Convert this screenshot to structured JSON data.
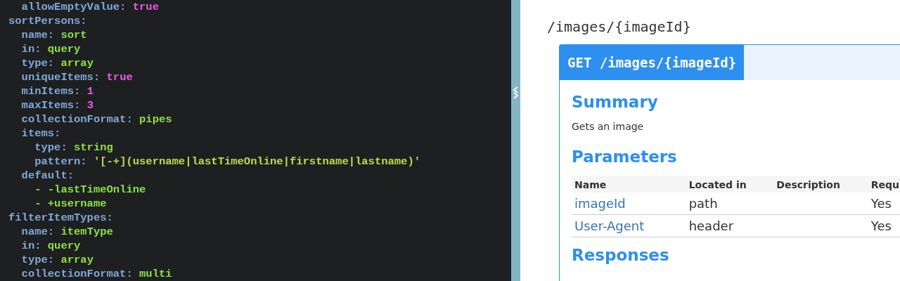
{
  "editor": {
    "lines": [
      {
        "children": [
          {
            "key": "allowEmptyValue:",
            "value": "true",
            "kind": "literal"
          }
        ]
      },
      {
        "key": "sortPersons:",
        "children": [
          {
            "key": "name:",
            "value": "sort",
            "kind": "string"
          },
          {
            "key": "in:",
            "value": "query",
            "kind": "string"
          },
          {
            "key": "type:",
            "value": "array",
            "kind": "string"
          },
          {
            "key": "uniqueItems:",
            "value": "true",
            "kind": "literal"
          },
          {
            "key": "minItems:",
            "value": "1",
            "kind": "literal"
          },
          {
            "key": "maxItems:",
            "value": "3",
            "kind": "literal"
          },
          {
            "key": "collectionFormat:",
            "value": "pipes",
            "kind": "string"
          },
          {
            "key": "items:",
            "children": [
              {
                "key": "type:",
                "value": "string",
                "kind": "string"
              },
              {
                "key": "pattern:",
                "value": "'[-+](username|lastTimeOnline|firstname|lastname)'",
                "kind": "quoted"
              }
            ]
          },
          {
            "key": "default:",
            "children": [
              {
                "item": "- -lastTimeOnline",
                "kind": "list"
              },
              {
                "item": "- +username",
                "kind": "list"
              }
            ]
          }
        ]
      },
      {
        "key": "filterItemTypes:",
        "children": [
          {
            "key": "name:",
            "value": "itemType",
            "kind": "string"
          },
          {
            "key": "in:",
            "value": "query",
            "kind": "string"
          },
          {
            "key": "type:",
            "value": "array",
            "kind": "string"
          },
          {
            "key": "collectionFormat:",
            "value": "multi",
            "kind": "string"
          }
        ]
      }
    ]
  },
  "docs": {
    "path": "/images/{imageId}",
    "operation": {
      "title": "GET /images/{imageId}",
      "summary_heading": "Summary",
      "summary": "Gets an image",
      "parameters_heading": "Parameters",
      "columns": [
        "Name",
        "Located in",
        "Description",
        "Requ"
      ],
      "rows": [
        {
          "name": "imageId",
          "located_in": "path",
          "required": "Yes"
        },
        {
          "name": "User-Agent",
          "located_in": "header",
          "required": "Yes"
        }
      ],
      "responses_heading": "Responses"
    }
  }
}
